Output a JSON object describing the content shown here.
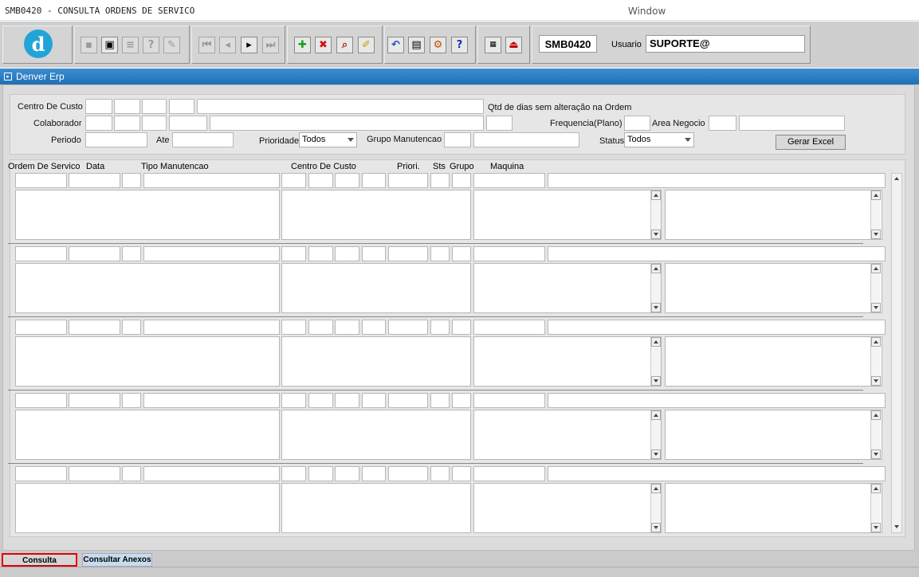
{
  "window": {
    "title": "SMB0420 - CONSULTA ORDENS DE SERVICO",
    "menu_window": "Window"
  },
  "toolbar": {
    "logo_letter": "d",
    "form_code": "SMB0420",
    "usuario_label": "Usuario",
    "usuario_value": "SUPORTE@",
    "buttons": [
      "save-icon",
      "print-preview-icon",
      "print-icon",
      "help-query-icon",
      "edit-icon",
      "first-record-icon",
      "prev-record-icon",
      "next-record-icon",
      "last-record-icon",
      "insert-record-icon",
      "delete-record-icon",
      "query-icon",
      "clear-icon",
      "undo-icon",
      "clipboard-icon",
      "tools-icon",
      "help-icon",
      "menu-icon",
      "exit-icon"
    ]
  },
  "frame": {
    "title": "Denver Erp"
  },
  "filters": {
    "centro_de_custo": "Centro De Custo",
    "qtd_dias": "Qtd de dias sem alteração na Ordem",
    "colaborador": "Colaborador",
    "frequencia": "Frequencia(Plano)",
    "area_negocio": "Area Negocio",
    "periodo": "Periodo",
    "ate": "Ate",
    "prioridade": "Prioridade",
    "prioridade_value": "Todos",
    "grupo_manutencao": "Grupo Manutencao",
    "status": "Status",
    "status_value": "Todos",
    "gerar_excel": "Gerar Excel"
  },
  "grid": {
    "headers": {
      "ordem": "Ordem De Servico",
      "data": "Data",
      "tipo": "Tipo Manutencao",
      "centro": "Centro De Custo",
      "priori": "Priori.",
      "sts": "Sts",
      "grupo": "Grupo",
      "maquina": "Maquina"
    }
  },
  "tabs": {
    "consulta": "Consulta",
    "anexos": "Consultar Anexos"
  }
}
